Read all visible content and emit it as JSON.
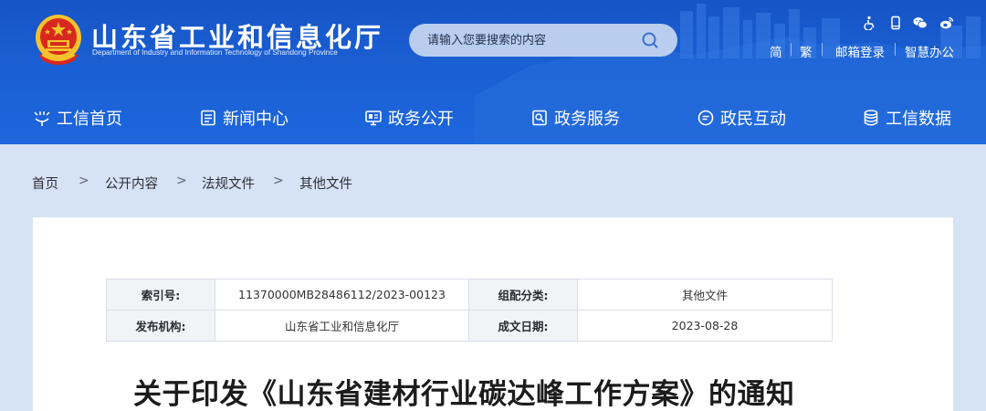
{
  "header": {
    "site_title": "山东省工业和信息化厅",
    "site_subtitle": "Department of Industry and Information Technology of Shandong Province",
    "search_placeholder": "请输入您要搜索的内容",
    "accessibility_icons": [
      "accessibility-icon",
      "mobile-icon",
      "wechat-icon",
      "weibo-icon"
    ],
    "links": {
      "simplified": "简",
      "traditional": "繁",
      "mail_login": "邮箱登录",
      "smart_office": "智慧办公"
    },
    "colors": {
      "primary": "#1a5fd3",
      "emblem_red": "#d7281f",
      "emblem_gold": "#f5c22e"
    }
  },
  "nav": {
    "items": [
      {
        "label": "工信首页",
        "icon": "home-icon"
      },
      {
        "label": "新闻中心",
        "icon": "news-icon"
      },
      {
        "label": "政务公开",
        "icon": "monitor-icon"
      },
      {
        "label": "政务服务",
        "icon": "service-icon"
      },
      {
        "label": "政民互动",
        "icon": "chat-icon"
      },
      {
        "label": "工信数据",
        "icon": "database-icon"
      }
    ]
  },
  "breadcrumb": {
    "items": [
      "首页",
      "公开内容",
      "法规文件",
      "其他文件"
    ],
    "separator": ">"
  },
  "meta": {
    "index_label": "索引号:",
    "index_value": "11370000MB28486112/2023-00123",
    "category_label": "组配分类:",
    "category_value": "其他文件",
    "issuer_label": "发布机构:",
    "issuer_value": "山东省工业和信息化厅",
    "date_label": "成文日期:",
    "date_value": "2023-08-28"
  },
  "article": {
    "title": "关于印发《山东省建材行业碳达峰工作方案》的通知"
  }
}
